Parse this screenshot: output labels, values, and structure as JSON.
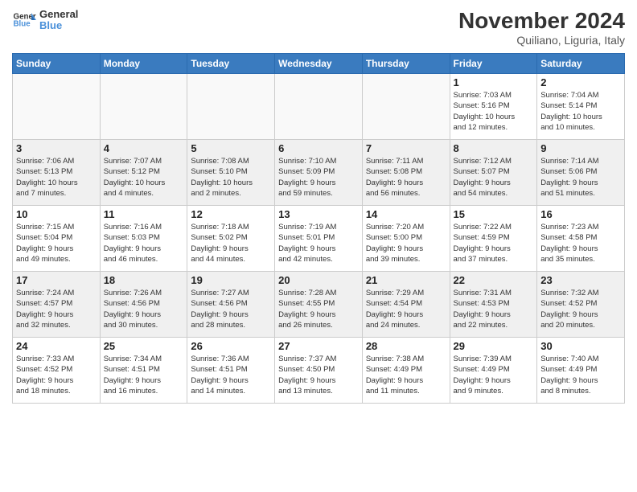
{
  "logo": {
    "line1": "General",
    "line2": "Blue"
  },
  "title": "November 2024",
  "location": "Quiliano, Liguria, Italy",
  "weekdays": [
    "Sunday",
    "Monday",
    "Tuesday",
    "Wednesday",
    "Thursday",
    "Friday",
    "Saturday"
  ],
  "weeks": [
    [
      {
        "day": "",
        "info": ""
      },
      {
        "day": "",
        "info": ""
      },
      {
        "day": "",
        "info": ""
      },
      {
        "day": "",
        "info": ""
      },
      {
        "day": "",
        "info": ""
      },
      {
        "day": "1",
        "info": "Sunrise: 7:03 AM\nSunset: 5:16 PM\nDaylight: 10 hours\nand 12 minutes."
      },
      {
        "day": "2",
        "info": "Sunrise: 7:04 AM\nSunset: 5:14 PM\nDaylight: 10 hours\nand 10 minutes."
      }
    ],
    [
      {
        "day": "3",
        "info": "Sunrise: 7:06 AM\nSunset: 5:13 PM\nDaylight: 10 hours\nand 7 minutes."
      },
      {
        "day": "4",
        "info": "Sunrise: 7:07 AM\nSunset: 5:12 PM\nDaylight: 10 hours\nand 4 minutes."
      },
      {
        "day": "5",
        "info": "Sunrise: 7:08 AM\nSunset: 5:10 PM\nDaylight: 10 hours\nand 2 minutes."
      },
      {
        "day": "6",
        "info": "Sunrise: 7:10 AM\nSunset: 5:09 PM\nDaylight: 9 hours\nand 59 minutes."
      },
      {
        "day": "7",
        "info": "Sunrise: 7:11 AM\nSunset: 5:08 PM\nDaylight: 9 hours\nand 56 minutes."
      },
      {
        "day": "8",
        "info": "Sunrise: 7:12 AM\nSunset: 5:07 PM\nDaylight: 9 hours\nand 54 minutes."
      },
      {
        "day": "9",
        "info": "Sunrise: 7:14 AM\nSunset: 5:06 PM\nDaylight: 9 hours\nand 51 minutes."
      }
    ],
    [
      {
        "day": "10",
        "info": "Sunrise: 7:15 AM\nSunset: 5:04 PM\nDaylight: 9 hours\nand 49 minutes."
      },
      {
        "day": "11",
        "info": "Sunrise: 7:16 AM\nSunset: 5:03 PM\nDaylight: 9 hours\nand 46 minutes."
      },
      {
        "day": "12",
        "info": "Sunrise: 7:18 AM\nSunset: 5:02 PM\nDaylight: 9 hours\nand 44 minutes."
      },
      {
        "day": "13",
        "info": "Sunrise: 7:19 AM\nSunset: 5:01 PM\nDaylight: 9 hours\nand 42 minutes."
      },
      {
        "day": "14",
        "info": "Sunrise: 7:20 AM\nSunset: 5:00 PM\nDaylight: 9 hours\nand 39 minutes."
      },
      {
        "day": "15",
        "info": "Sunrise: 7:22 AM\nSunset: 4:59 PM\nDaylight: 9 hours\nand 37 minutes."
      },
      {
        "day": "16",
        "info": "Sunrise: 7:23 AM\nSunset: 4:58 PM\nDaylight: 9 hours\nand 35 minutes."
      }
    ],
    [
      {
        "day": "17",
        "info": "Sunrise: 7:24 AM\nSunset: 4:57 PM\nDaylight: 9 hours\nand 32 minutes."
      },
      {
        "day": "18",
        "info": "Sunrise: 7:26 AM\nSunset: 4:56 PM\nDaylight: 9 hours\nand 30 minutes."
      },
      {
        "day": "19",
        "info": "Sunrise: 7:27 AM\nSunset: 4:56 PM\nDaylight: 9 hours\nand 28 minutes."
      },
      {
        "day": "20",
        "info": "Sunrise: 7:28 AM\nSunset: 4:55 PM\nDaylight: 9 hours\nand 26 minutes."
      },
      {
        "day": "21",
        "info": "Sunrise: 7:29 AM\nSunset: 4:54 PM\nDaylight: 9 hours\nand 24 minutes."
      },
      {
        "day": "22",
        "info": "Sunrise: 7:31 AM\nSunset: 4:53 PM\nDaylight: 9 hours\nand 22 minutes."
      },
      {
        "day": "23",
        "info": "Sunrise: 7:32 AM\nSunset: 4:52 PM\nDaylight: 9 hours\nand 20 minutes."
      }
    ],
    [
      {
        "day": "24",
        "info": "Sunrise: 7:33 AM\nSunset: 4:52 PM\nDaylight: 9 hours\nand 18 minutes."
      },
      {
        "day": "25",
        "info": "Sunrise: 7:34 AM\nSunset: 4:51 PM\nDaylight: 9 hours\nand 16 minutes."
      },
      {
        "day": "26",
        "info": "Sunrise: 7:36 AM\nSunset: 4:51 PM\nDaylight: 9 hours\nand 14 minutes."
      },
      {
        "day": "27",
        "info": "Sunrise: 7:37 AM\nSunset: 4:50 PM\nDaylight: 9 hours\nand 13 minutes."
      },
      {
        "day": "28",
        "info": "Sunrise: 7:38 AM\nSunset: 4:49 PM\nDaylight: 9 hours\nand 11 minutes."
      },
      {
        "day": "29",
        "info": "Sunrise: 7:39 AM\nSunset: 4:49 PM\nDaylight: 9 hours\nand 9 minutes."
      },
      {
        "day": "30",
        "info": "Sunrise: 7:40 AM\nSunset: 4:49 PM\nDaylight: 9 hours\nand 8 minutes."
      }
    ]
  ]
}
